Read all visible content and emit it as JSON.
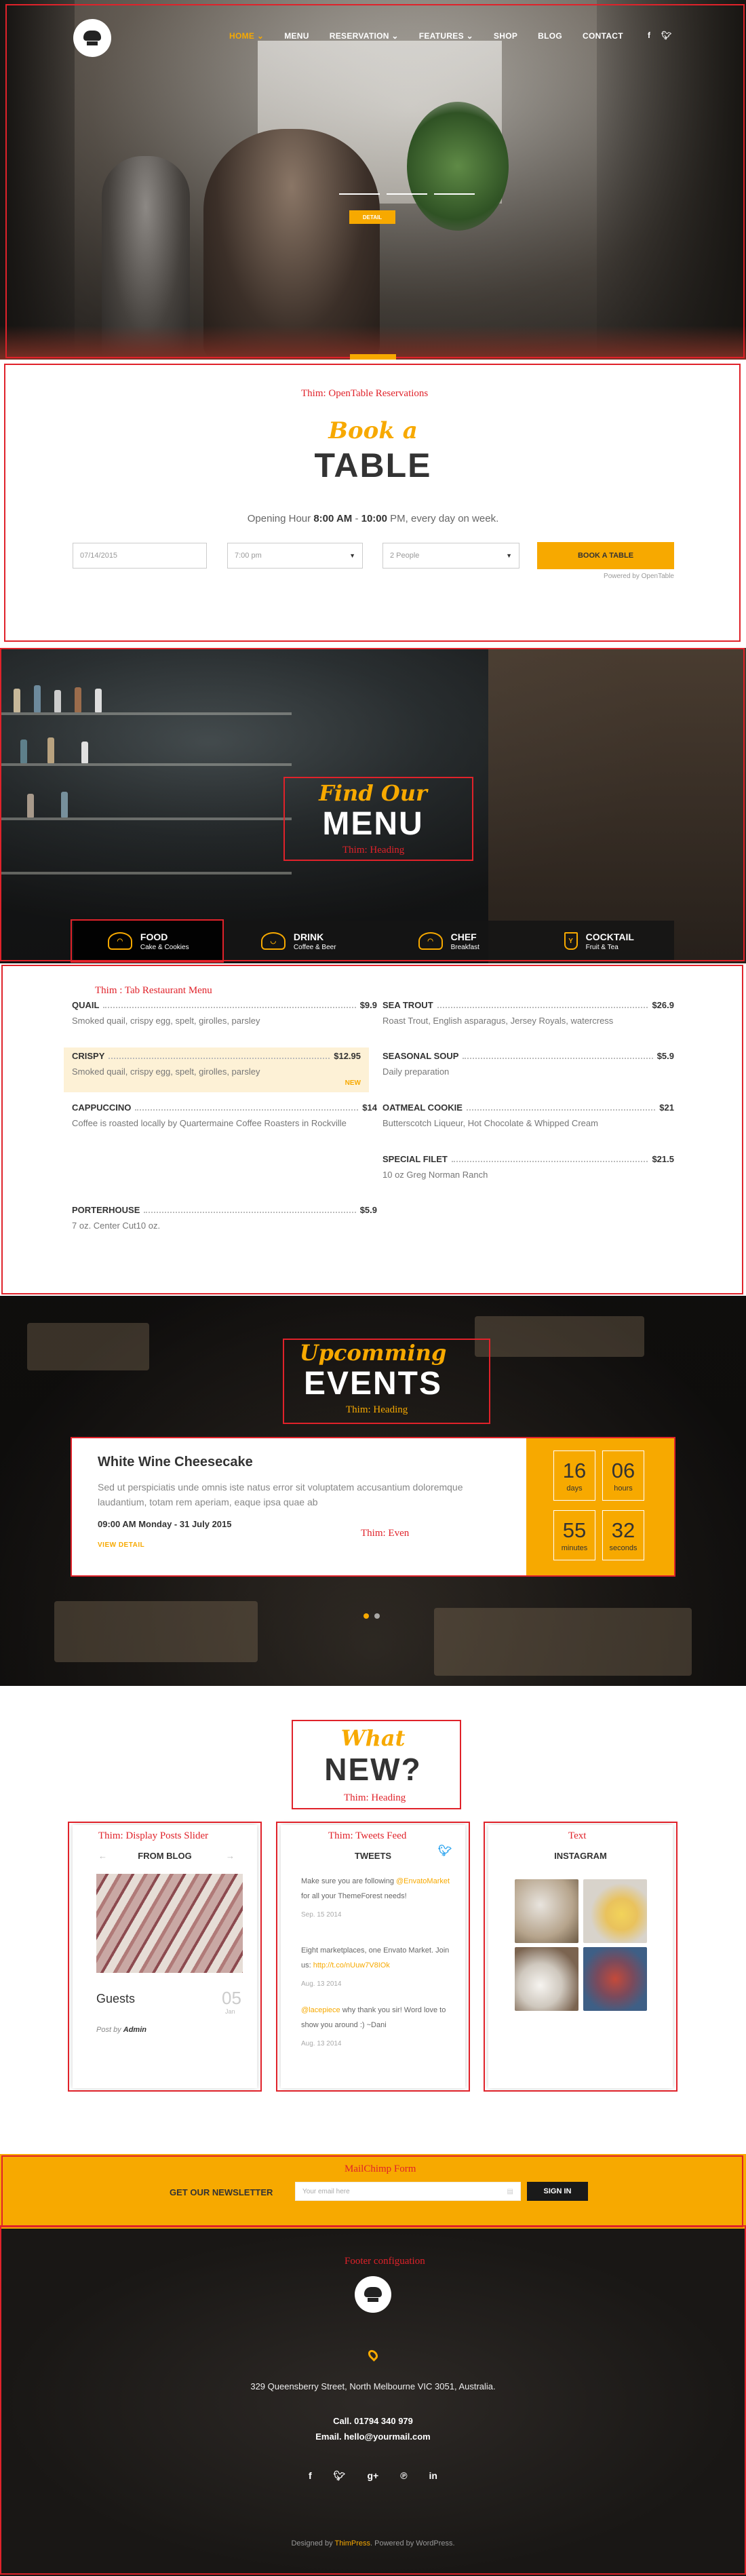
{
  "colors": {
    "accent": "#f7a900",
    "annotation": "#e0222a",
    "dark": "#1a1a1a"
  },
  "header": {
    "logo_icon": "chef-hat-icon",
    "nav": [
      {
        "label": "HOME",
        "caret": "⌄",
        "active": true
      },
      {
        "label": "MENU",
        "caret": "",
        "active": false
      },
      {
        "label": "RESERVATION",
        "caret": "⌄",
        "active": false
      },
      {
        "label": "FEATURES",
        "caret": "⌄",
        "active": false
      },
      {
        "label": "SHOP",
        "caret": "",
        "active": false
      },
      {
        "label": "BLOG",
        "caret": "",
        "active": false
      },
      {
        "label": "CONTACT",
        "caret": "",
        "active": false
      }
    ],
    "social": [
      "f",
      "twitter"
    ],
    "hero_button": "DETAIL"
  },
  "reservation": {
    "annotation": "Thim: OpenTable Reservations",
    "script": "Book a",
    "title": "TABLE",
    "hours_prefix": "Opening Hour ",
    "hours_open": "8:00 AM",
    "hours_sep": " - ",
    "hours_close": "10:00",
    "hours_suffix": " PM, every day on week.",
    "date_value": "07/14/2015",
    "time_value": "7:00 pm",
    "people_value": "2 People",
    "button": "BOOK A TABLE",
    "powered": "Powered by OpenTable"
  },
  "menu_hero": {
    "script": "Find Our",
    "title": "MENU",
    "annotation": "Thim: Heading",
    "tabs": [
      {
        "name": "FOOD",
        "sub": "Cake & Cookies",
        "icon": "food-icon"
      },
      {
        "name": "DRINK",
        "sub": "Coffee & Beer",
        "icon": "drink-icon"
      },
      {
        "name": "CHEF",
        "sub": "Breakfast",
        "icon": "chef-icon"
      },
      {
        "name": "COCKTAIL",
        "sub": "Fruit & Tea",
        "icon": "cocktail-icon"
      }
    ]
  },
  "menu_list": {
    "annotation": "Thim : Tab Restaurant Menu",
    "left": [
      {
        "name": "QUAIL",
        "price": "$9.9",
        "desc": "Smoked quail, crispy egg, spelt, girolles, parsley"
      },
      {
        "name": "CRISPY",
        "price": "$12.95",
        "desc": "Smoked quail, crispy egg, spelt, girolles, parsley",
        "badge": "NEW"
      },
      {
        "name": "CAPPUCCINO",
        "price": "$14",
        "desc": "Coffee is roasted locally by Quartermaine Coffee Roasters in Rockville"
      },
      {
        "name": "PORTERHOUSE",
        "price": "$5.9",
        "desc": "7 oz. Center Cut10 oz."
      }
    ],
    "right": [
      {
        "name": "SEA TROUT",
        "price": "$26.9",
        "desc": "Roast Trout, English asparagus, Jersey Royals, watercress"
      },
      {
        "name": "SEASONAL SOUP",
        "price": "$5.9",
        "desc": "Daily preparation"
      },
      {
        "name": "OATMEAL COOKIE",
        "price": "$21",
        "desc": "Butterscotch Liqueur, Hot Chocolate & Whipped Cream"
      },
      {
        "name": "SPECIAL FILET",
        "price": "$21.5",
        "desc": "10 oz Greg Norman Ranch"
      }
    ]
  },
  "events": {
    "script": "Upcomming",
    "title": "EVENTS",
    "annotation": "Thim: Heading",
    "card_annotation": "Thim: Even",
    "name": "White Wine Cheesecake",
    "desc": "Sed ut perspiciatis unde omnis iste natus error sit voluptatem accusantium doloremque laudantium, totam rem aperiam, eaque ipsa quae ab",
    "date": "09:00 AM Monday - 31 July 2015",
    "link": "VIEW DETAIL",
    "countdown": [
      {
        "num": "16",
        "label": "days"
      },
      {
        "num": "06",
        "label": "hours"
      },
      {
        "num": "55",
        "label": "minutes"
      },
      {
        "num": "32",
        "label": "seconds"
      }
    ]
  },
  "whats_new": {
    "script": "What",
    "title": "NEW?",
    "annotation": "Thim: Heading",
    "blog": {
      "annotation": "Thim: Display Posts Slider",
      "title": "FROM BLOG",
      "post_title": "Guests",
      "day": "05",
      "month": "Jan",
      "post_by": "Post by ",
      "author": "Admin"
    },
    "tweets": {
      "annotation": "Thim: Tweets Feed",
      "title": "TWEETS",
      "items": [
        {
          "pre": "Make sure you are following ",
          "link": "@EnvatoMarket",
          "post": " for all your ThemeForest needs!",
          "date": "Sep. 15 2014"
        },
        {
          "pre": "Eight marketplaces, one Envato Market. Join us: ",
          "link": "http://t.co/nUuw7V8IOk",
          "post": "",
          "date": "Aug. 13 2014"
        },
        {
          "pre": "",
          "link": "@lacepiece",
          "post": " why thank you sir! Word love to show you around :) ~Dani",
          "date": "Aug. 13 2014"
        }
      ]
    },
    "instagram": {
      "annotation": "Text",
      "title": "INSTAGRAM"
    }
  },
  "newsletter": {
    "annotation": "MailChimp Form",
    "label": "GET OUR NEWSLETTER",
    "placeholder": "Your email here",
    "button": "SIGN IN"
  },
  "footer": {
    "annotation": "Footer configuation",
    "address": "329 Queensberry Street, North Melbourne VIC 3051, Australia.",
    "call": "Call. 01794 340 979",
    "email": "Email. hello@yourmail.com",
    "social": [
      "f",
      "twitter",
      "g+",
      "pinterest",
      "in"
    ],
    "copy_prefix": "Designed by ",
    "copy_brand": "ThimPress",
    "copy_suffix": ". Powered by WordPress."
  }
}
